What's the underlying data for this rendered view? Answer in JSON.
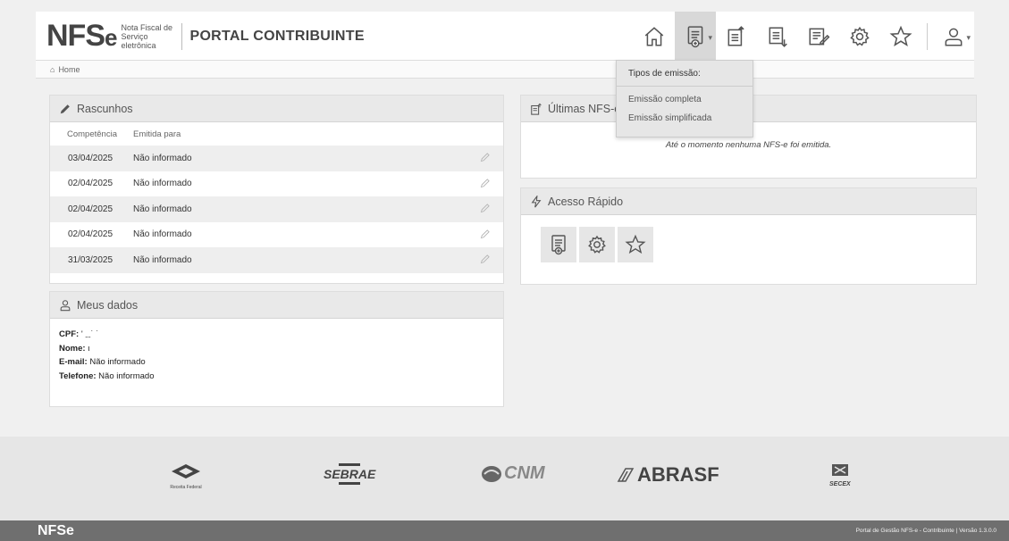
{
  "header": {
    "logo_mark": "NFS",
    "logo_suffix": "e",
    "logo_sub_line1": "Nota Fiscal de",
    "logo_sub_line2": "Serviço eletrônica",
    "portal_title": "PORTAL CONTRIBUINTE",
    "icons": [
      "home-icon",
      "new-invoice-icon",
      "upload-invoice-icon",
      "download-invoice-icon",
      "edit-invoice-icon",
      "gear-icon",
      "star-icon",
      "user-icon"
    ]
  },
  "breadcrumb": {
    "home": "Home"
  },
  "dropdown": {
    "title": "Tipos de emissão:",
    "items": [
      "Emissão completa",
      "Emissão simplificada"
    ]
  },
  "drafts": {
    "title": "Rascunhos",
    "columns": [
      "Competência",
      "Emitida para"
    ],
    "rows": [
      {
        "date": "03/04/2025",
        "recipient": "Não informado"
      },
      {
        "date": "02/04/2025",
        "recipient": "Não informado"
      },
      {
        "date": "02/04/2025",
        "recipient": "Não informado"
      },
      {
        "date": "02/04/2025",
        "recipient": "Não informado"
      },
      {
        "date": "31/03/2025",
        "recipient": "Não informado"
      }
    ]
  },
  "mydata": {
    "title": "Meus dados",
    "cpf_label": "CPF:",
    "cpf_value": "' ˍˍ˙ ˙",
    "name_label": "Nome:",
    "name_value": "ι",
    "email_label": "E-mail:",
    "email_value": "Não informado",
    "phone_label": "Telefone:",
    "phone_value": "Não informado"
  },
  "lastnfse": {
    "title": "Últimas NFS-e",
    "empty_message": "Até o momento nenhuma NFS-e foi emitida."
  },
  "quick": {
    "title": "Acesso Rápido"
  },
  "partners": {
    "sebrae": "SEBRAE",
    "cnm": "CNM",
    "abrasf": "ABRASF",
    "secex": "SECEX",
    "receita": "Receita Federal"
  },
  "footer": {
    "logo": "NFSe",
    "version": "Portal de Gestão NFS-e - Contribuinte | Versão 1.3.0.0"
  },
  "colors": {
    "background": "#f0f0f0",
    "panel_header": "#e9e9e9",
    "footer": "#6f6f6f"
  }
}
